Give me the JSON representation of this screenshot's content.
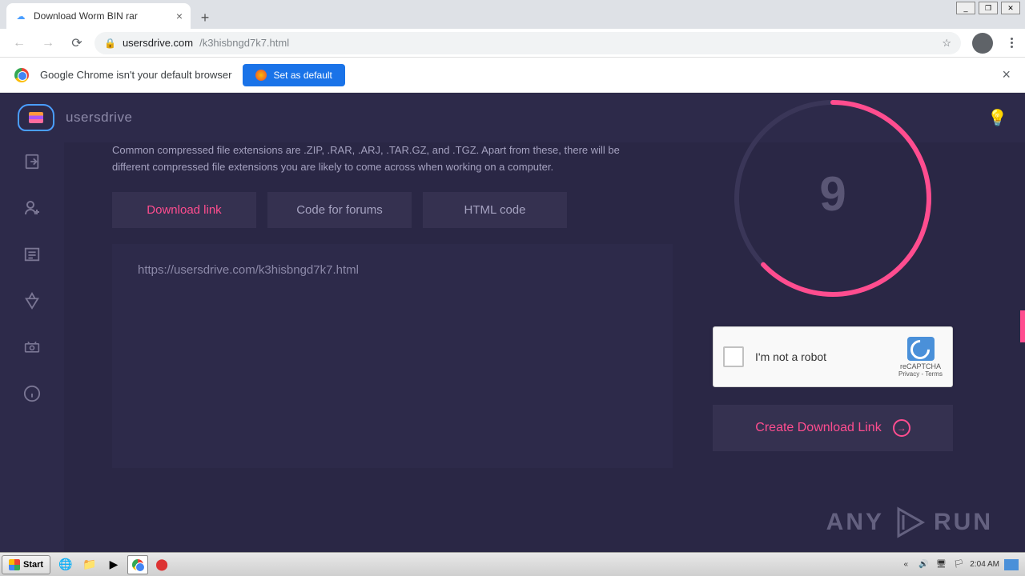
{
  "window": {
    "min": "_",
    "max": "❐",
    "close": "✕"
  },
  "tab": {
    "title": "Download Worm BIN rar"
  },
  "url": {
    "domain": "usersdrive.com",
    "path": "/k3hisbngd7k7.html"
  },
  "infobar": {
    "text": "Google Chrome isn't your default browser",
    "button": "Set as default"
  },
  "brand": "usersdrive",
  "description1": "Common compressed file extensions are .ZIP, .RAR, .ARJ, .TAR.GZ, and .TGZ. Apart from these, there will be",
  "description2": "different compressed file extensions you are likely to come across when working on a computer.",
  "tabs": {
    "download": "Download link",
    "forums": "Code for forums",
    "html": "HTML code"
  },
  "link": "https://usersdrive.com/k3hisbngd7k7.html",
  "countdown": "9",
  "recaptcha": {
    "label": "I'm not a robot",
    "brand": "reCAPTCHA",
    "links": "Privacy - Terms"
  },
  "create_button": "Create Download Link",
  "watermark": {
    "t1": "ANY",
    "t2": "RUN"
  },
  "taskbar": {
    "start": "Start",
    "time": "2:04 AM"
  }
}
